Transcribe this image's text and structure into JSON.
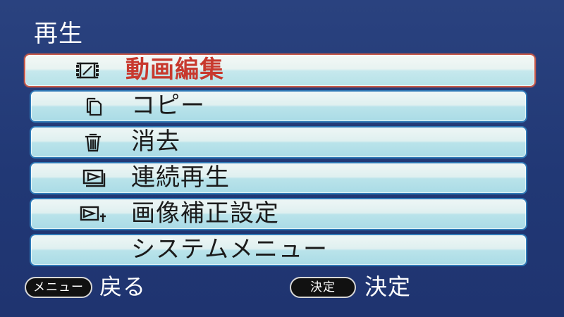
{
  "header": {
    "title": "再生"
  },
  "menu": {
    "items": [
      {
        "label": "動画編集",
        "icon": "film-edit-icon",
        "selected": true
      },
      {
        "label": "コピー",
        "icon": "copy-icon",
        "selected": false
      },
      {
        "label": "消去",
        "icon": "trash-icon",
        "selected": false
      },
      {
        "label": "連続再生",
        "icon": "slideshow-icon",
        "selected": false
      },
      {
        "label": "画像補正設定",
        "icon": "image-adjust-icon",
        "selected": false
      },
      {
        "label": "システムメニュー",
        "icon": "",
        "selected": false
      }
    ]
  },
  "footer": {
    "menu_button_label": "メニュー",
    "back_label": "戻る",
    "confirm_button_label": "決定",
    "confirm_label": "決定"
  },
  "colors": {
    "background": "#233a78",
    "selected_text": "#c8392e",
    "item_border": "#2f79b6",
    "selected_border": "#c65a4a"
  }
}
